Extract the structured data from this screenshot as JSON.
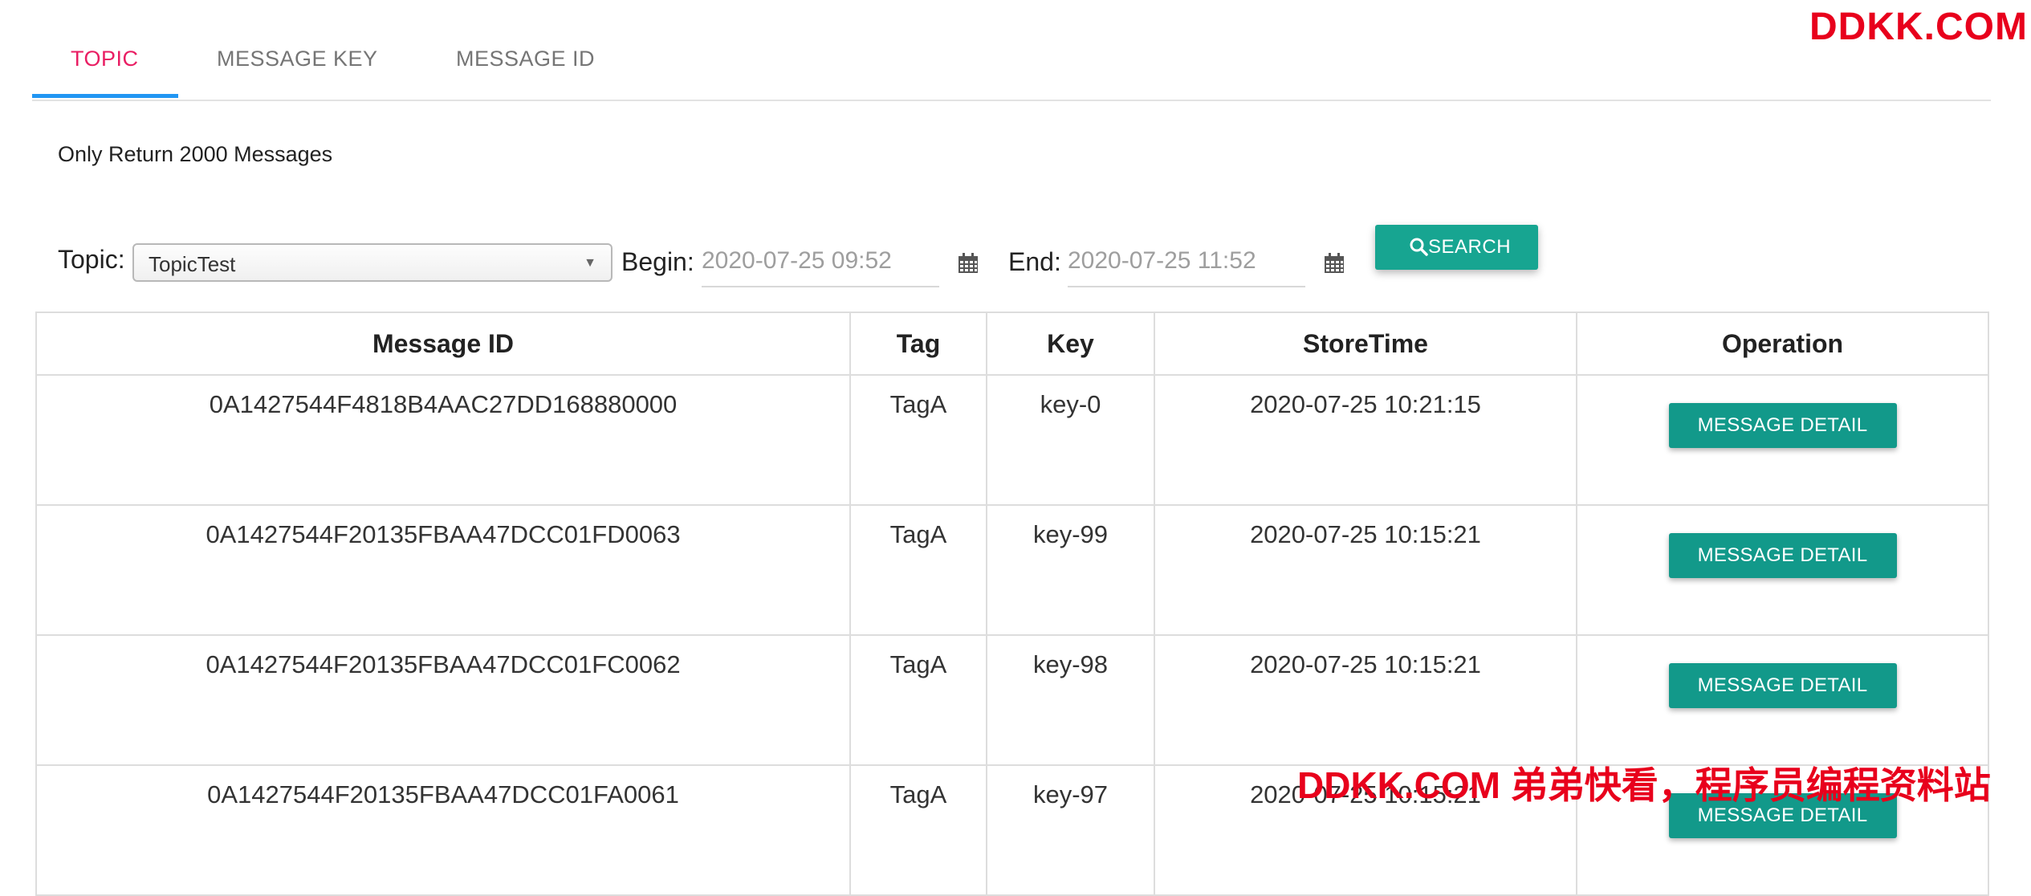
{
  "tabs": [
    {
      "label": "TOPIC",
      "active": true
    },
    {
      "label": "MESSAGE KEY",
      "active": false
    },
    {
      "label": "MESSAGE ID",
      "active": false
    }
  ],
  "watermark_top": "DDKK.COM",
  "watermark_bottom": "DDKK.COM 弟弟快看，程序员编程资料站",
  "notice": "Only Return 2000 Messages",
  "filters": {
    "topic_label": "Topic:",
    "topic_value": "TopicTest",
    "begin_label": "Begin:",
    "begin_value": "2020-07-25 09:52",
    "end_label": "End:",
    "end_value": "2020-07-25 11:52",
    "search_label": "SEARCH"
  },
  "table": {
    "columns": [
      "Message ID",
      "Tag",
      "Key",
      "StoreTime",
      "Operation"
    ],
    "rows": [
      {
        "message_id": "0A1427544F4818B4AAC27DD168880000",
        "tag": "TagA",
        "key": "key-0",
        "store_time": "2020-07-25 10:21:15",
        "operation": "MESSAGE DETAIL"
      },
      {
        "message_id": "0A1427544F20135FBAA47DCC01FD0063",
        "tag": "TagA",
        "key": "key-99",
        "store_time": "2020-07-25 10:15:21",
        "operation": "MESSAGE DETAIL"
      },
      {
        "message_id": "0A1427544F20135FBAA47DCC01FC0062",
        "tag": "TagA",
        "key": "key-98",
        "store_time": "2020-07-25 10:15:21",
        "operation": "MESSAGE DETAIL"
      },
      {
        "message_id": "0A1427544F20135FBAA47DCC01FA0061",
        "tag": "TagA",
        "key": "key-97",
        "store_time": "2020-07-25 10:15:21",
        "operation": "MESSAGE DETAIL"
      }
    ]
  },
  "icons": {
    "calendar": "calendar-icon",
    "search": "search-icon",
    "dropdown": "caret-down-icon"
  },
  "colors": {
    "active_tab": "#e91e63",
    "tab_indicator": "#2196f3",
    "button": "#17a591",
    "watermark": "#e8001c"
  }
}
